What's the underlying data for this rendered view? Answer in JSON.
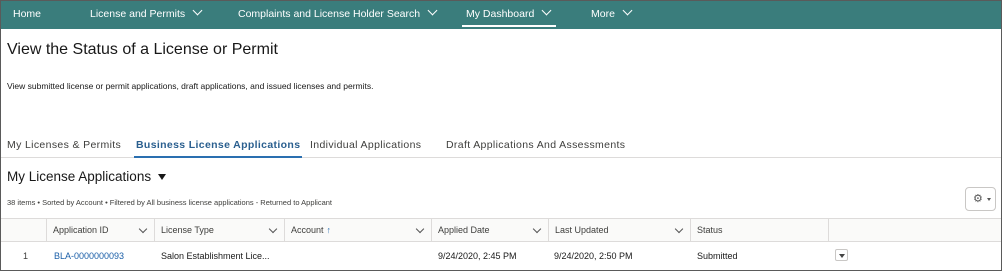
{
  "nav": {
    "home": "Home",
    "license_permits": "License and Permits",
    "complaints": "Complaints and License Holder Search",
    "dashboard": "My Dashboard",
    "more": "More"
  },
  "page": {
    "title": "View the Status of a License or Permit",
    "description": "View submitted license or permit applications, draft applications, and issued licenses and permits."
  },
  "tabs": [
    {
      "label": "My Licenses & Permits",
      "active": false
    },
    {
      "label": "Business License Applications",
      "active": true
    },
    {
      "label": "Individual Applications",
      "active": false
    },
    {
      "label": "Draft Applications And Assessments",
      "active": false
    }
  ],
  "list": {
    "title": "My License Applications",
    "meta": "38 items • Sorted by Account • Filtered by All business license applications - Returned to Applicant"
  },
  "table": {
    "columns": [
      "Application ID",
      "License Type",
      "Account",
      "Applied Date",
      "Last Updated",
      "Status"
    ],
    "sort_arrow": "↑",
    "rows": [
      {
        "num": "1",
        "application_id": "BLA-0000000093",
        "license_type": "Salon Establishment Lice...",
        "account": "",
        "applied_date": "9/24/2020, 2:45 PM",
        "last_updated": "9/24/2020, 2:50 PM",
        "status": "Submitted"
      }
    ]
  },
  "colors": {
    "nav_bg": "#3a7d7c",
    "link": "#1b5fa8",
    "active_tab": "#2a5f8f"
  },
  "icons": [
    "chevron-down-icon",
    "caret-down-icon",
    "gear-icon",
    "sort-up-arrow-icon"
  ]
}
